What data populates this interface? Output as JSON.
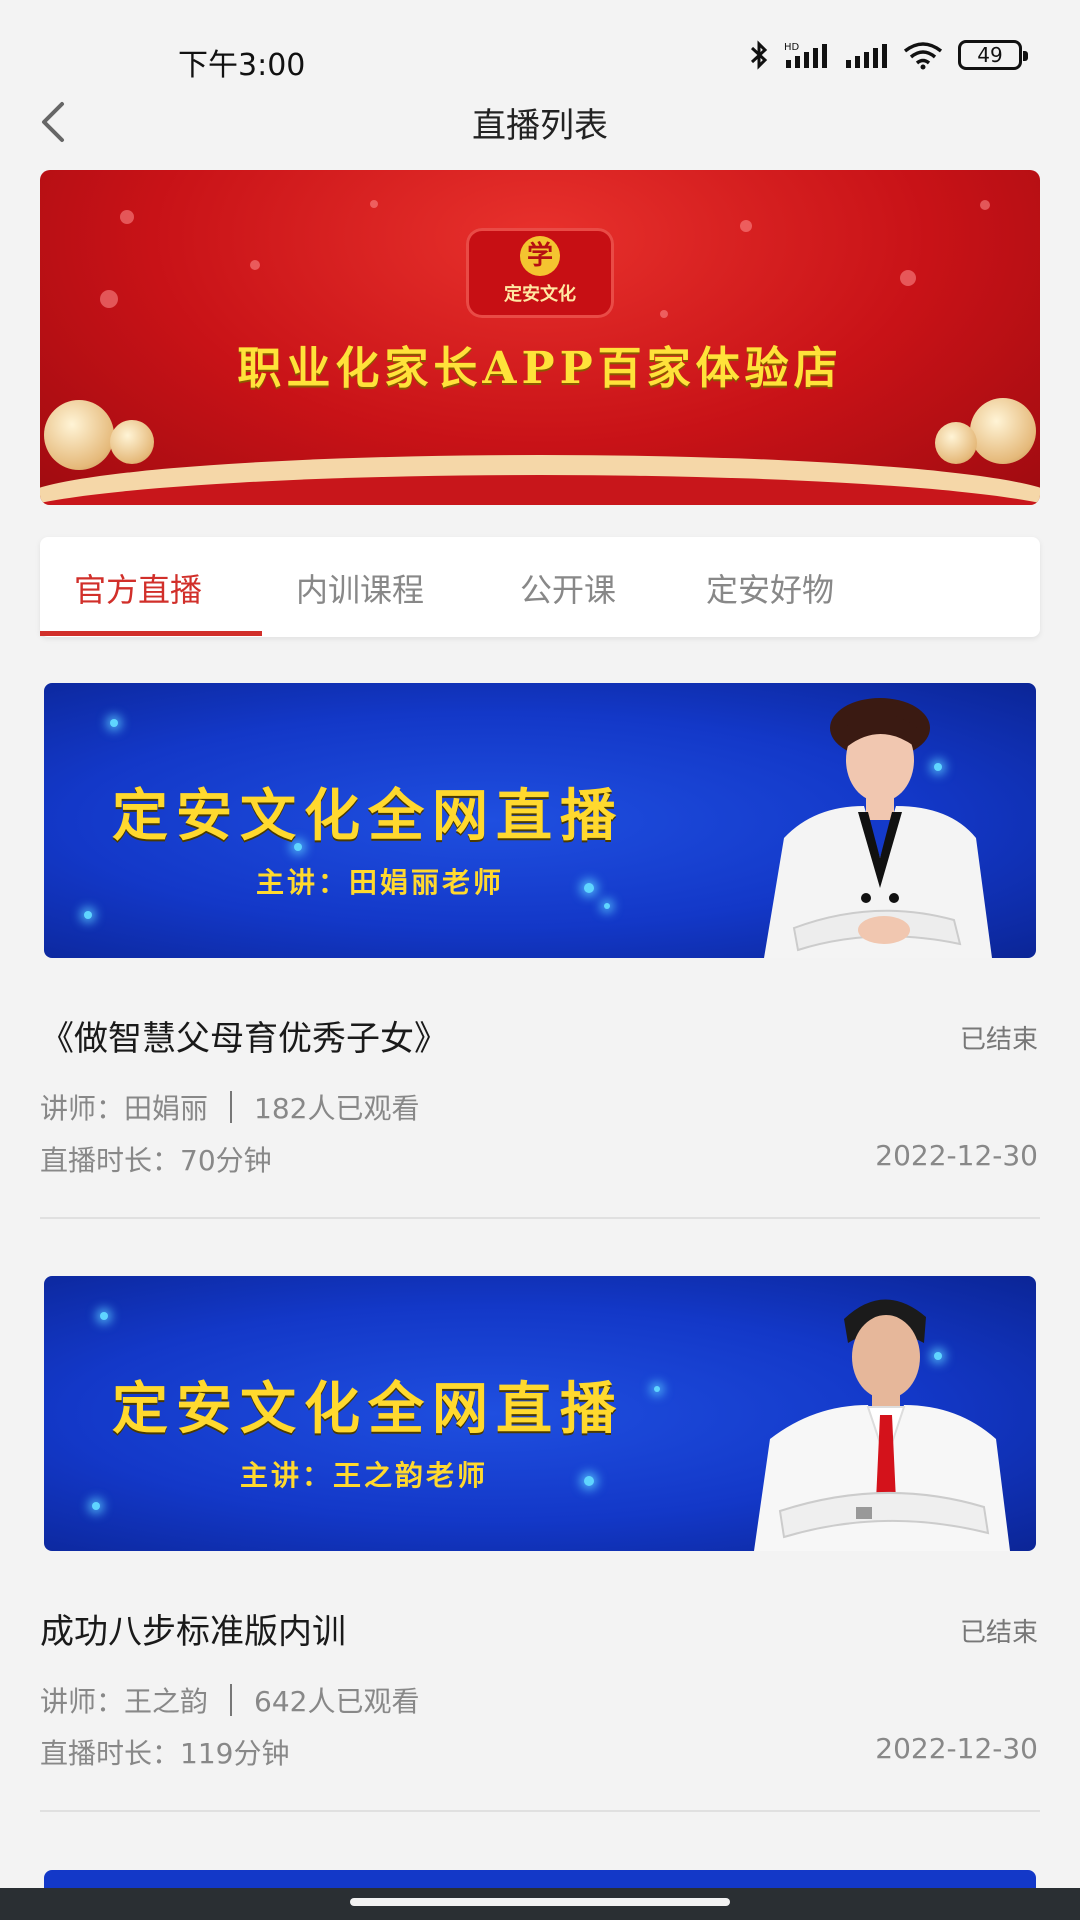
{
  "status_bar": {
    "time": "下午3:00",
    "battery": "49"
  },
  "header": {
    "title": "直播列表"
  },
  "top_banner": {
    "logo_mark": "学",
    "logo_text": "定安文化",
    "headline": "职业化家长APP百家体验店"
  },
  "tabs": [
    {
      "label": "官方直播",
      "active": true
    },
    {
      "label": "内训课程",
      "active": false
    },
    {
      "label": "公开课",
      "active": false
    },
    {
      "label": "定安好物",
      "active": false
    }
  ],
  "items": [
    {
      "banner_title": "定安文化全网直播",
      "banner_speaker": "主讲：田娟丽老师",
      "title": "《做智慧父母育优秀子女》",
      "status": "已结束",
      "lecturer": "讲师：田娟丽",
      "views": "182人已观看",
      "duration": "直播时长：70分钟",
      "date": "2022-12-30"
    },
    {
      "banner_title": "定安文化全网直播",
      "banner_speaker": "主讲：王之韵老师",
      "title": "成功八步标准版内训",
      "status": "已结束",
      "lecturer": "讲师：王之韵",
      "views": "642人已观看",
      "duration": "直播时长：119分钟",
      "date": "2022-12-30"
    }
  ],
  "colors": {
    "accent": "#d12f2a",
    "banner_red": "#c81217",
    "banner_blue": "#1338c8",
    "banner_text": "#ffd92e"
  }
}
